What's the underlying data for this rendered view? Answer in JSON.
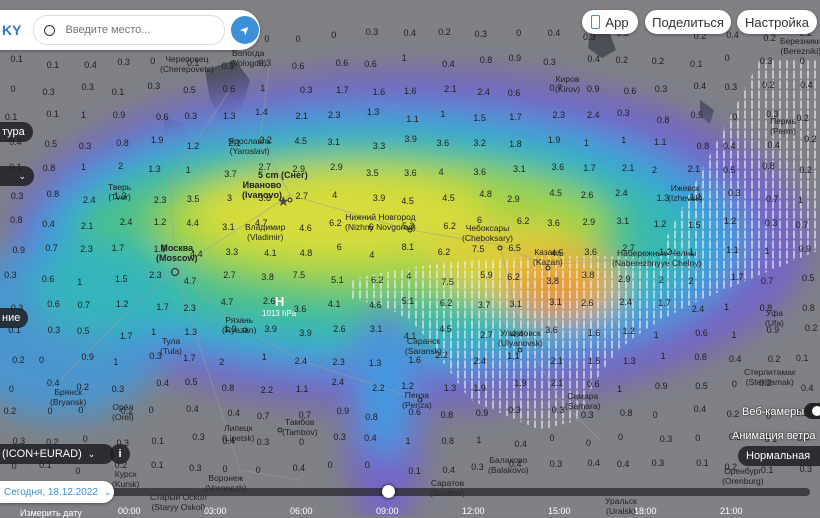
{
  "header": {
    "logo_fragment": "KY",
    "search_placeholder": "Введите место...",
    "app_label": "App",
    "share_label": "Поделиться",
    "settings_label": "Настройка"
  },
  "left_controls": {
    "layer_fragment": "тура",
    "model_label": "(ICON+EURAD)",
    "info_symbol": "i",
    "side_fragment_1": "ние"
  },
  "right_controls": {
    "webcams_label": "Веб-камеры",
    "wind_anim_label": "Анимация ветра",
    "wind_anim_value": "Нормальная"
  },
  "timeline": {
    "date_label": "Сегодня, 18.12.2022",
    "times": [
      "00:00",
      "03:00",
      "06:00",
      "09:00",
      "12:00",
      "15:00",
      "18:00",
      "21:00"
    ],
    "footer_fragment": "Измерить дату"
  },
  "marker": {
    "snow_label": "5 cm (Снег)",
    "pressure_label": "1013 hPa",
    "pressure_symbol": "H"
  },
  "colors": {
    "accent": "#3d8fd9",
    "map_bg": "#7d7f83"
  },
  "cities": [
    {
      "ru": "Череповец",
      "en": "Cherepovets"
    },
    {
      "ru": "Вологда",
      "en": "Vologda"
    },
    {
      "ru": "Киров",
      "en": "Kirov"
    },
    {
      "ru": "Пермь",
      "en": "Perm"
    },
    {
      "ru": "Березники",
      "en": "Berezniki"
    },
    {
      "ru": "Ярославль",
      "en": "Yaroslavl"
    },
    {
      "ru": "Иваново",
      "en": "Ivanovo"
    },
    {
      "ru": "Тверь",
      "en": "Tver"
    },
    {
      "ru": "Ижевск",
      "en": "Izhevsk"
    },
    {
      "ru": "Владимир",
      "en": "Vladimir"
    },
    {
      "ru": "Нижний Новгород",
      "en": "Nizhny Novgorod"
    },
    {
      "ru": "Чебоксары",
      "en": "Cheboksary"
    },
    {
      "ru": "Казань",
      "en": "Kazan"
    },
    {
      "ru": "Набережные Челны",
      "en": "Naberezhnyye Chelny"
    },
    {
      "ru": "Москва",
      "en": "Moscow"
    },
    {
      "ru": "Рязань",
      "en": "Ryazan"
    },
    {
      "ru": "Тула",
      "en": "Tula"
    },
    {
      "ru": "Уфа",
      "en": "Ufa"
    },
    {
      "ru": "Саранск",
      "en": "Saransk"
    },
    {
      "ru": "Ульяновск",
      "en": "Ulyanovsk"
    },
    {
      "ru": "Стерлитамак",
      "en": "Sterlitamak"
    },
    {
      "ru": "Брянск",
      "en": "Bryansk"
    },
    {
      "ru": "Орёл",
      "en": "Orel"
    },
    {
      "ru": "Пенза",
      "en": "Penza"
    },
    {
      "ru": "Самара",
      "en": "Samara"
    },
    {
      "ru": "Липецк",
      "en": "Lipetsk"
    },
    {
      "ru": "Тамбов",
      "en": "Tambov"
    },
    {
      "ru": "Курск",
      "en": "Kursk"
    },
    {
      "ru": "Воронеж",
      "en": "Voronezh"
    },
    {
      "ru": "Балаково",
      "en": "Balakovo"
    },
    {
      "ru": "Старый Оскол",
      "en": "Staryy Oskol"
    },
    {
      "ru": "Саратов",
      "en": "Saratov"
    },
    {
      "ru": "Оренбург",
      "en": "Orenburg"
    },
    {
      "ru": "Уральск",
      "en": "Uralsk"
    }
  ],
  "values": [
    "0",
    "0.1",
    "0.2",
    "0.3",
    "0.4",
    "0.5",
    "0.6",
    "0.7",
    "0.8",
    "0.9",
    "1",
    "1.1",
    "1.2",
    "1.3",
    "1.4",
    "1.5",
    "1.6",
    "1.7",
    "1.8",
    "1.9",
    "2",
    "2.1",
    "2.2",
    "2.3",
    "2.4",
    "2.6",
    "2.7",
    "2.9",
    "3",
    "3.1",
    "3.2",
    "3.3",
    "3.5",
    "3.6",
    "3.7",
    "3.8",
    "3.9",
    "4",
    "4.1",
    "4.4",
    "4.5",
    "4.6",
    "4.7",
    "4.8",
    "5",
    "5.1",
    "5.3",
    "5.6",
    "5.9",
    "6",
    "6.2",
    "6.5",
    "6.7",
    "7.5",
    "8.1"
  ]
}
